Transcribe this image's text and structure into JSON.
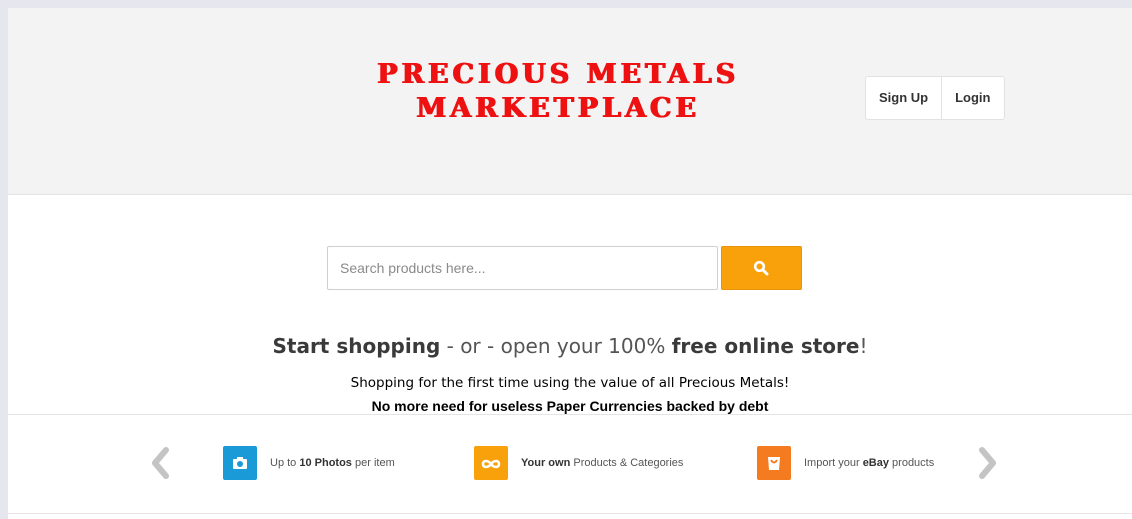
{
  "header": {
    "logo_line1": "PRECIOUS METALS",
    "logo_line2": "MARKETPLACE",
    "signup_label": "Sign Up",
    "login_label": "Login"
  },
  "search": {
    "placeholder": "Search products here...",
    "button_icon": "search-icon"
  },
  "hero": {
    "tagline_part1": "Start shopping",
    "tagline_part2": " - or - open your 100% ",
    "tagline_part3": "free online store",
    "tagline_part4": "!",
    "line2": "Shopping for the first time using the value of all Precious Metals!",
    "line3": "No more need for useless Paper Currencies backed by debt"
  },
  "features": [
    {
      "icon": "camera-icon",
      "color": "#1a9ad6",
      "pre": "Up to ",
      "bold": "10 Photos",
      "post": " per item"
    },
    {
      "icon": "infinity-icon",
      "color": "#f8a10a",
      "pre": "",
      "bold": "Your own",
      "post": " Products & Categories"
    },
    {
      "icon": "shopping-bag-icon",
      "color": "#f47b20",
      "pre": "Import your ",
      "bold": "eBay",
      "post": " products"
    }
  ],
  "colors": {
    "logo": "#ee1111",
    "search_button": "#f8a10a",
    "header_bg": "#f3f3f3"
  }
}
